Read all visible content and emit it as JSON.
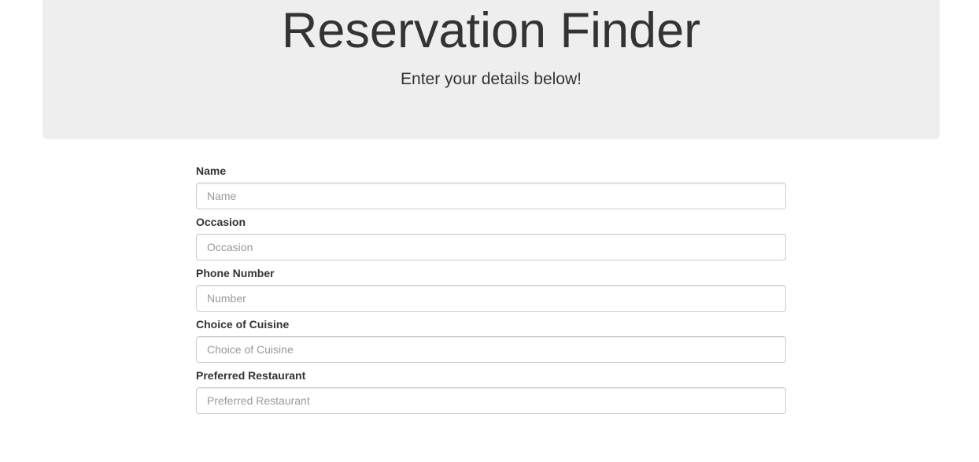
{
  "header": {
    "title": "Reservation Finder",
    "subtitle": "Enter your details below!"
  },
  "form": {
    "fields": [
      {
        "label": "Name",
        "placeholder": "Name",
        "value": ""
      },
      {
        "label": "Occasion",
        "placeholder": "Occasion",
        "value": ""
      },
      {
        "label": "Phone Number",
        "placeholder": "Number",
        "value": ""
      },
      {
        "label": "Choice of Cuisine",
        "placeholder": "Choice of Cuisine",
        "value": ""
      },
      {
        "label": "Preferred Restaurant",
        "placeholder": "Preferred Restaurant",
        "value": ""
      }
    ]
  }
}
